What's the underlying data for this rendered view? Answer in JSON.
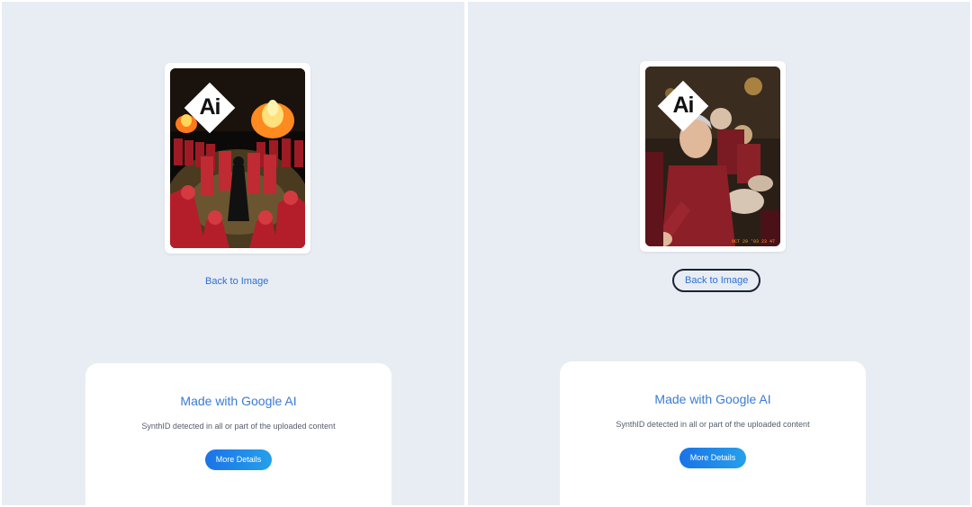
{
  "panels": [
    {
      "badge": "Ai",
      "back_label": "Back to Image",
      "card": {
        "title": "Made with Google AI",
        "subtitle": "SynthID detected in all or part of the uploaded content",
        "button": "More Details"
      }
    },
    {
      "badge": "Ai",
      "back_label": "Back to Image",
      "card": {
        "title": "Made with Google AI",
        "subtitle": "SynthID detected in all or part of the uploaded content",
        "button": "More Details"
      }
    }
  ],
  "colors": {
    "background": "#e8edf4",
    "link": "#2f6fd0",
    "card_title": "#3a7bd5",
    "button_start": "#1a73e8",
    "button_end": "#26a0ea",
    "robe": "#b41e2a",
    "fire": "#ff9a1f"
  },
  "icons": {
    "badge": "ai-diamond-icon"
  },
  "photo_timestamp": "OCT 29 '03 23 47"
}
